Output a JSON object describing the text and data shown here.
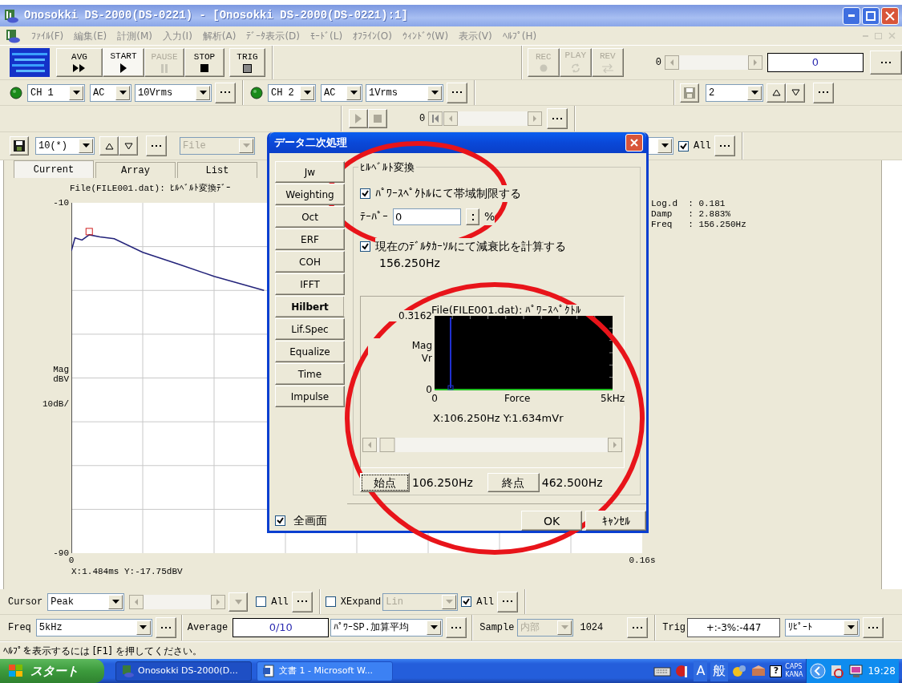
{
  "window": {
    "title": "Onosokki DS-2000(DS-0221) - [Onosokki DS-2000(DS-0221):1]"
  },
  "menu": [
    "ﾌｧｲﾙ(F)",
    "編集(E)",
    "計測(M)",
    "入力(I)",
    "解析(A)",
    "ﾃﾞｰﾀ表示(D)",
    "ﾓｰﾄﾞ(L)",
    "ｵﾌﾗｲﾝ(O)",
    "ｳｨﾝﾄﾞｳ(W)",
    "表示(V)",
    "ﾍﾙﾌﾟ(H)"
  ],
  "measure_buttons": [
    {
      "label": "AVG",
      "kind": "double-play",
      "disabled": false,
      "pressed": false
    },
    {
      "label": "START",
      "kind": "play",
      "disabled": false,
      "pressed": true
    },
    {
      "label": "PAUSE",
      "kind": "pause",
      "disabled": true,
      "pressed": false
    },
    {
      "label": "STOP",
      "kind": "stop",
      "disabled": false,
      "pressed": false
    },
    {
      "label": "TRIG",
      "kind": "square",
      "disabled": false,
      "pressed": false
    }
  ],
  "record_buttons": [
    {
      "label": "REC",
      "kind": "dot",
      "disabled": true
    },
    {
      "label": "PLAY",
      "kind": "cycle",
      "disabled": true
    },
    {
      "label": "REV",
      "kind": "swap",
      "disabled": true
    }
  ],
  "position": {
    "minimum": "0",
    "value": "0"
  },
  "channels": [
    {
      "color": "#1a8a1a",
      "channel": "CH 1",
      "coupling": "AC",
      "range": "10Vrms"
    },
    {
      "color": "#1a8a1a",
      "channel": "CH 2",
      "coupling": "AC",
      "range": "1Vrms"
    }
  ],
  "memory": {
    "slot": "2"
  },
  "playback": {
    "counter": "0"
  },
  "data_bar": {
    "count": "10(*)",
    "source": "File",
    "all": {
      "label": "All",
      "checked": true
    }
  },
  "view_tabs": [
    {
      "label": "Current",
      "selected": true
    },
    {
      "label": "Array",
      "selected": false
    },
    {
      "label": "List",
      "selected": false
    }
  ],
  "plot": {
    "y_unit": "dBV",
    "y_scale": "10dB/",
    "readout": "X:1.484ms Y:-17.75dBV",
    "chart_data": {
      "type": "line",
      "title": "File(FILE001.dat): ﾋﾙﾍﾞﾙﾄ変換ﾃﾞｰ",
      "ylabel": "Mag",
      "x": [
        0,
        0.001,
        0.003,
        0.005,
        0.008,
        0.012,
        0.02,
        0.03,
        0.04,
        0.054
      ],
      "series": [
        {
          "color": "#23237a",
          "values": [
            -21,
            -18,
            -18.5,
            -17.3,
            -17.8,
            -18.2,
            -21.3,
            -24,
            -26.8,
            -30
          ]
        }
      ],
      "xlim": [
        0,
        0.16
      ],
      "ylim": [
        -90,
        -10
      ],
      "xticks": [
        {
          "value": 0,
          "label": "0"
        },
        {
          "value": 0.16,
          "label": "0.16s"
        }
      ],
      "yticks": [
        {
          "value": -10,
          "label": "-10"
        },
        {
          "value": -90,
          "label": "-90"
        }
      ]
    }
  },
  "results": [
    "Log.d  : 0.181",
    "Damp   : 2.883%",
    "Freq   : 156.250Hz"
  ],
  "dialog": {
    "title": "データ二次処理",
    "methods": [
      {
        "label": "Jw",
        "selected": false
      },
      {
        "label": "Weighting",
        "selected": false
      },
      {
        "label": "Oct",
        "selected": false
      },
      {
        "label": "ERF",
        "selected": false
      },
      {
        "label": "COH",
        "selected": false
      },
      {
        "label": "IFFT",
        "selected": false
      },
      {
        "label": "Hilbert",
        "selected": true
      },
      {
        "label": "Lif.Spec",
        "selected": false
      },
      {
        "label": "Equalize",
        "selected": false
      },
      {
        "label": "Time",
        "selected": false
      },
      {
        "label": "Impulse",
        "selected": false
      }
    ],
    "group_title": "ﾋﾙﾍﾞﾙﾄ変換",
    "band_limit": {
      "label": "ﾊﾟﾜｰｽﾍﾟｸﾄﾙにて帯域制限する",
      "checked": true
    },
    "taper": {
      "label": "ﾃｰﾊﾟｰ",
      "value": "0",
      "unit": "%"
    },
    "damping": {
      "label": "現在のﾃﾞﾙﾀｶｰｿﾙにて減衰比を計算する",
      "checked": true,
      "frequency": "156.250Hz"
    },
    "preview": {
      "y_unit": "Vr",
      "readout": "X:106.250Hz Y:1.634mVr",
      "chart_data": {
        "type": "line",
        "title": "File(FILE001.dat): ﾊﾟﾜｰｽﾍﾟｸﾄﾙ",
        "xlabel": "Force",
        "ylabel": "Mag",
        "x": [
          0,
          5
        ],
        "series": [
          {
            "color": "#22c022",
            "values": [
              0,
              0
            ]
          }
        ],
        "ref_lines": [
          {
            "axis": "x",
            "value": 0.45,
            "color": "#2030d0"
          }
        ],
        "xlim": [
          0,
          5
        ],
        "ylim": [
          0,
          0.3162
        ],
        "xticks": [
          {
            "value": 0,
            "label": "0"
          },
          {
            "value": 5,
            "label": "5kHz"
          }
        ],
        "yticks": [
          {
            "value": 0,
            "label": "0"
          },
          {
            "value": 0.3162,
            "label": "0.3162"
          }
        ]
      }
    },
    "start": {
      "label": "始点",
      "value": "106.250Hz"
    },
    "end": {
      "label": "終点",
      "value": "462.500Hz"
    },
    "fullscreen": {
      "label": "全画面",
      "checked": true
    },
    "buttons": [
      "OK",
      "ｷｬﾝｾﾙ"
    ]
  },
  "cursor_bar": {
    "label": "Cursor",
    "mode": "Peak",
    "all": {
      "label": "All",
      "checked": false
    },
    "xexpand": {
      "label": "XExpand",
      "checked": false
    },
    "scale": "Lin",
    "all_x": {
      "label": "All",
      "checked": true
    }
  },
  "settings_bar": {
    "freq_label": "Freq",
    "freq": "5kHz",
    "average_label": "Average",
    "average": "0/10",
    "average_mode": "ﾊﾟﾜｰSP.加算平均",
    "sample_label": "Sample",
    "sample_source": "内部",
    "sample_count": "1024",
    "trig_label": "Trig",
    "trig": "+:-3%:-447",
    "trig_mode": "ﾘﾋﾟｰﾄ"
  },
  "status_bar": "ﾍﾙﾌﾟを表示するには [F1] を押してください。",
  "taskbar": {
    "start": "スタート",
    "tasks": [
      {
        "label": "Onosokki DS-2000(D...",
        "selected": true
      },
      {
        "label": "文書 1 - Microsoft W...",
        "selected": false
      }
    ],
    "ime": [
      "A",
      "般"
    ],
    "help": "?",
    "caps": "CAPS",
    "kana": "KANA",
    "clock": "19:28"
  },
  "annotations": [
    {
      "kind": "ellipse"
    },
    {
      "kind": "ellipse"
    }
  ]
}
